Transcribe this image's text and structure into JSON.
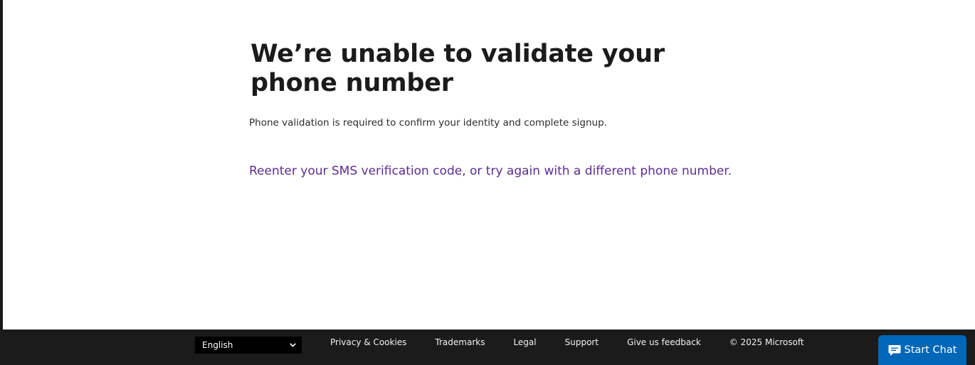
{
  "main": {
    "title": "We’re unable to validate your phone number",
    "subtitle": "Phone validation is required to confirm your identity and complete signup.",
    "retry_link": "Reenter your SMS verification code, or try again with a different phone number."
  },
  "footer": {
    "language": "English",
    "links": {
      "privacy": "Privacy & Cookies",
      "trademarks": "Trademarks",
      "legal": "Legal",
      "support": "Support",
      "feedback": "Give us feedback"
    },
    "copyright": "© 2025 Microsoft"
  },
  "chat": {
    "label": "Start Chat",
    "icon": "chat-bubble-icon"
  },
  "colors": {
    "footer_bg": "#1b1b1b",
    "link": "#5c2d91",
    "chat_button": "#0067b8"
  }
}
